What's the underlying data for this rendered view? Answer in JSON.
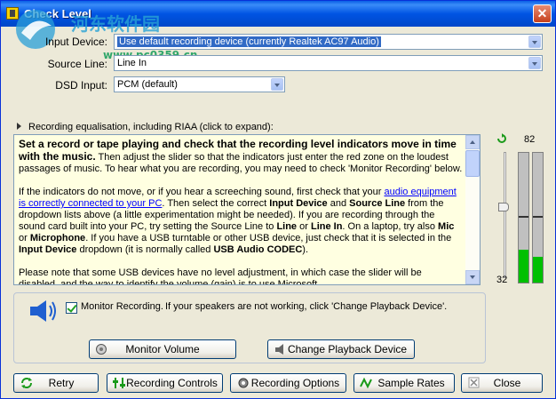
{
  "window": {
    "title": "Check Level"
  },
  "watermark": {
    "text": "河东软件园",
    "url": "www.pc0359.cn"
  },
  "form": {
    "input_device_label": "Input Device:",
    "input_device_value": "Use default recording device (currently Realtek AC97 Audio)",
    "source_line_label": "Source Line:",
    "source_line_value": "Line In",
    "dsd_input_label": "DSD Input:",
    "dsd_input_value": "PCM (default)"
  },
  "equalisation": {
    "label": "Recording equalisation, including RIAA (click to expand):"
  },
  "info": {
    "p1_bold": "Set a record or tape playing and check that the recording level indicators move in time with the music.",
    "p1_rest": "Then adjust the slider so that the indicators just enter the red zone on the loudest passages of music. To hear what you are recording, you may need to check 'Monitor Recording' below.",
    "p2_a": "If the indicators do not move, or if you hear a screeching sound, first check that your ",
    "p2_link": "audio equipment is correctly connected to your PC",
    "p2_b": ". Then select the correct ",
    "p2_b1": "Input Device",
    "p2_c": " and ",
    "p2_c1": "Source Line",
    "p2_d": " from the dropdown lists above (a little experimentation might be needed). If you are recording through the sound card built into your PC, try setting the Source Line to ",
    "p2_d1": "Line",
    "p2_e": " or ",
    "p2_e1": "Line In",
    "p2_f": ". On a laptop, try also ",
    "p2_f1": "Mic",
    "p2_g": " or ",
    "p2_g1": "Microphone",
    "p2_h": ". If you have a USB turntable or other USB device, just check that it is selected in the ",
    "p2_h1": "Input Device",
    "p2_i": " dropdown (it is normally called ",
    "p2_i1": "USB Audio CODEC",
    "p2_j": ").",
    "p3": "Please note that some USB devices have no level adjustment, in which case the slider will be disabled, and the way to identify the volume (gain) is to use Microsoft"
  },
  "meter": {
    "top_label": "82",
    "bottom_label": "32",
    "slider_level": 0.6,
    "left_level": 0.25,
    "right_level": 0.2,
    "left_peak": 0.5,
    "right_peak": 0.5
  },
  "monitor": {
    "checkbox_label": "Monitor Recording.",
    "hint": "If your speakers are not working, click 'Change Playback Device'.",
    "checked": true
  },
  "buttons": {
    "monitor_volume": "Monitor Volume",
    "change_playback": "Change Playback Device",
    "retry": "Retry",
    "recording_controls": "Recording Controls",
    "recording_options": "Recording Options",
    "sample_rates": "Sample Rates",
    "close": "Close"
  },
  "colors": {
    "titlebar": "#0054e3",
    "info_bg": "#ffffe1",
    "meter_green": "#00c000",
    "selection": "#316ac5"
  }
}
